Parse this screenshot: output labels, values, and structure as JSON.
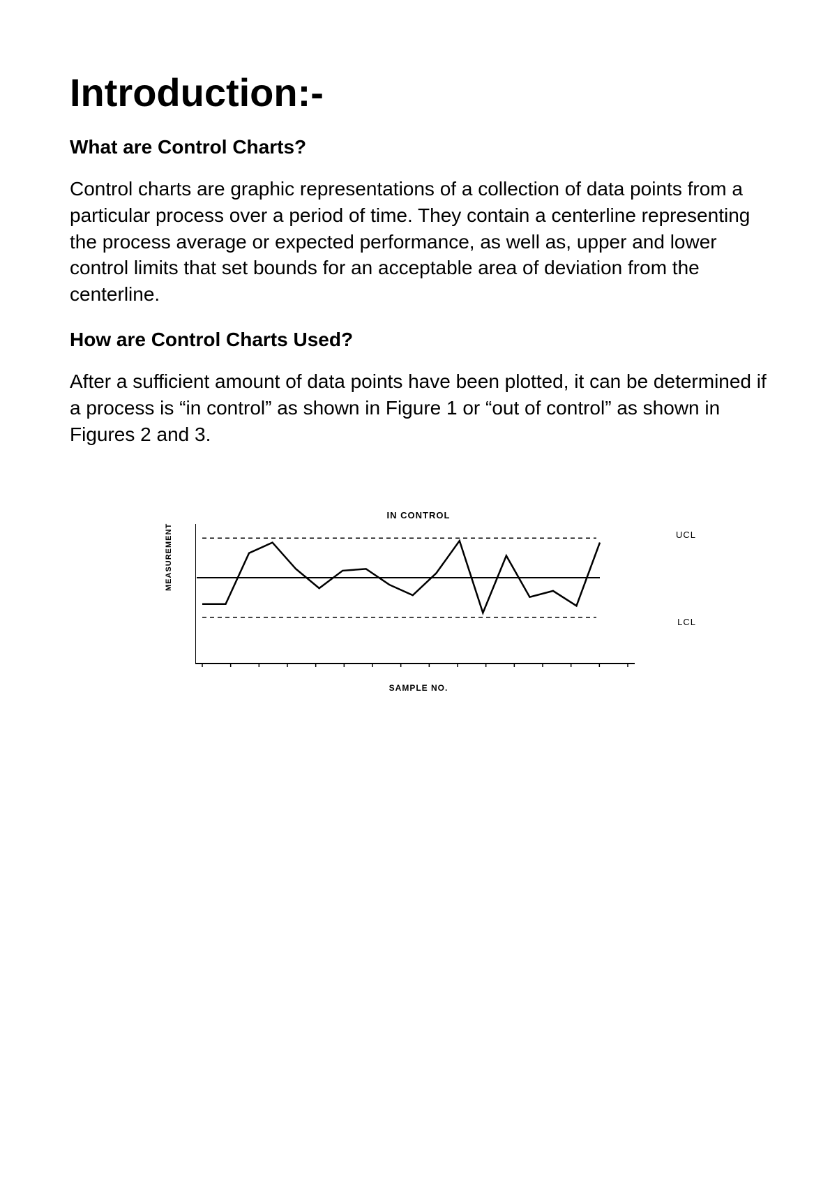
{
  "title": "Introduction:-",
  "sections": [
    {
      "heading": "What are Control Charts?",
      "body": "Control charts are graphic representations of a collection of data points from a particular process over a period of time. They contain a centerline representing the process average or expected performance, as well as, upper and lower control limits that set bounds for an acceptable area of deviation from the centerline."
    },
    {
      "heading": "How are Control Charts Used?",
      "body": "After a sufficient amount of data points have been plotted, it can be determined if a process is “in control” as shown in Figure 1 or “out of control” as shown in Figures 2 and 3."
    }
  ],
  "chart_data": {
    "type": "line",
    "title": "IN CONTROL",
    "xlabel": "SAMPLE NO.",
    "ylabel": "MEASUREMENT",
    "ucl_label": "UCL",
    "lcl_label": "LCL",
    "ucl": 95,
    "center": 50,
    "lcl": 5,
    "ylim": [
      0,
      100
    ],
    "x": [
      0,
      1,
      2,
      3,
      4,
      5,
      6,
      7,
      8,
      9,
      10,
      11,
      12,
      13,
      14,
      15
    ],
    "values": [
      20,
      20,
      78,
      90,
      60,
      38,
      58,
      60,
      42,
      30,
      55,
      92,
      10,
      75,
      28,
      35,
      18,
      90
    ]
  }
}
